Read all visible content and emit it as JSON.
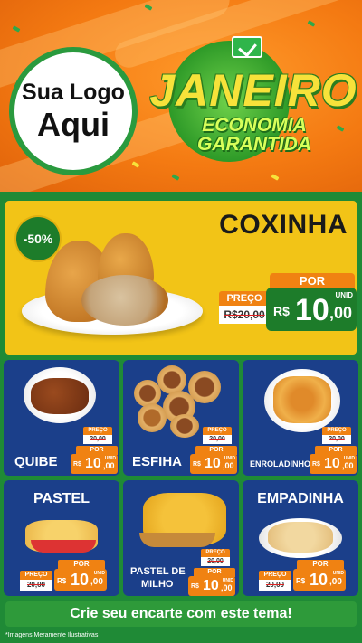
{
  "header": {
    "logo_line1": "Sua Logo",
    "logo_line2": "Aqui",
    "month": "JANEIRO",
    "tagline_line1": "ECONOMIA",
    "tagline_line2": "GARANTIDA"
  },
  "featured": {
    "discount": "-50%",
    "name": "COXINHA",
    "preco_label": "PREÇO",
    "old_price": "R$20,00",
    "por_label": "POR",
    "currency": "R$",
    "price_int": "10",
    "price_cents": ",00",
    "unit": "UNID"
  },
  "products": [
    {
      "name": "QUIBE",
      "preco_label": "PREÇO",
      "old_price": "20,00",
      "por_label": "POR",
      "currency": "R$",
      "price_int": "10",
      "price_cents": ",00",
      "unit": "UNID"
    },
    {
      "name": "ESFIHA",
      "preco_label": "PREÇO",
      "old_price": "20,00",
      "por_label": "POR",
      "currency": "R$",
      "price_int": "10",
      "price_cents": ",00",
      "unit": "UNID"
    },
    {
      "name": "ENROLADINHO",
      "preco_label": "PREÇO",
      "old_price": "20,00",
      "por_label": "POR",
      "currency": "R$",
      "price_int": "10",
      "price_cents": ",00",
      "unit": "UNID"
    },
    {
      "name": "PASTEL",
      "preco_label": "PREÇO",
      "old_price": "20,00",
      "por_label": "POR",
      "currency": "R$",
      "price_int": "10",
      "price_cents": ",00",
      "unit": "UNID"
    },
    {
      "name_line1": "PASTEL DE",
      "name_line2": "MILHO",
      "preco_label": "PREÇO",
      "old_price": "20,00",
      "por_label": "POR",
      "currency": "R$",
      "price_int": "10",
      "price_cents": ",00",
      "unit": "UNID"
    },
    {
      "name": "EMPADINHA",
      "preco_label": "PREÇO",
      "old_price": "20,00",
      "por_label": "POR",
      "currency": "R$",
      "price_int": "10",
      "price_cents": ",00",
      "unit": "UNID"
    }
  ],
  "footer": {
    "cta": "Crie seu encarte com este tema!",
    "disclaimer": "*Imagens Meramente Ilustrativas"
  },
  "colors": {
    "header_orange": "#f47a12",
    "brand_green": "#1d7c2a",
    "hero_yellow": "#f2c417",
    "card_blue": "#1b3f8a",
    "price_orange": "#f08212"
  }
}
